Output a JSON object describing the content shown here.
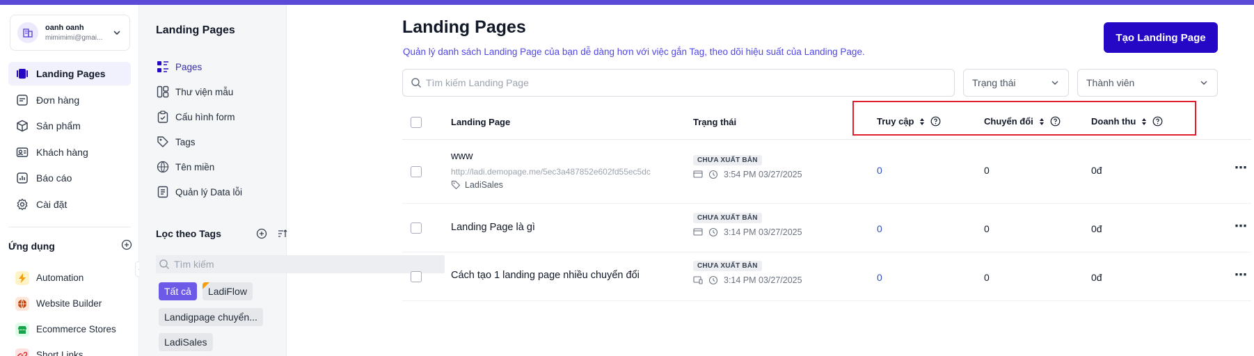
{
  "account": {
    "name": "oanh oanh",
    "email": "mimimimi@gmai..."
  },
  "nav": {
    "items": [
      {
        "label": "Landing Pages",
        "icon": "landing-pages-icon",
        "active": true
      },
      {
        "label": "Đơn hàng",
        "icon": "orders-icon"
      },
      {
        "label": "Sản phẩm",
        "icon": "products-icon"
      },
      {
        "label": "Khách hàng",
        "icon": "customers-icon"
      },
      {
        "label": "Báo cáo",
        "icon": "reports-icon"
      },
      {
        "label": "Cài đặt",
        "icon": "settings-icon"
      }
    ]
  },
  "apps": {
    "title": "Ứng dụng",
    "items": [
      {
        "label": "Automation",
        "icon": "automation-icon",
        "color": "#f59e0b"
      },
      {
        "label": "Website Builder",
        "icon": "website-builder-icon",
        "color": "#c2410c"
      },
      {
        "label": "Ecommerce Stores",
        "icon": "ecommerce-stores-icon",
        "color": "#16a34a"
      },
      {
        "label": "Short Links",
        "icon": "short-links-icon",
        "color": "#dc2626"
      }
    ]
  },
  "subpanel": {
    "title": "Landing Pages",
    "items": [
      {
        "label": "Pages",
        "icon": "pages-icon",
        "active": true
      },
      {
        "label": "Thư viện mẫu",
        "icon": "template-library-icon"
      },
      {
        "label": "Cấu hình form",
        "icon": "form-config-icon"
      },
      {
        "label": "Tags",
        "icon": "tag-icon"
      },
      {
        "label": "Tên miền",
        "icon": "domain-icon"
      },
      {
        "label": "Quản lý Data lỗi",
        "icon": "error-data-icon"
      }
    ],
    "tags_title": "Lọc theo Tags",
    "tags_search_placeholder": "Tìm kiếm",
    "tags": [
      "Tất cả",
      "LadiFlow",
      "Landigpage chuyển...",
      "LadiSales"
    ]
  },
  "main": {
    "title": "Landing Pages",
    "description": "Quản lý danh sách Landing Page của bạn dễ dàng hơn với việc gắn Tag, theo dõi hiệu suất của Landing Page.",
    "create_button": "Tạo Landing Page",
    "search_placeholder": "Tìm kiếm Landing Page",
    "filter_status": "Trạng thái",
    "filter_member": "Thành viên",
    "columns": {
      "landing_page": "Landing Page",
      "status": "Trạng thái",
      "visits": "Truy cập",
      "conversions": "Chuyển đổi",
      "revenue": "Doanh thu"
    },
    "rows": [
      {
        "name": "www",
        "url": "http://ladi.demopage.me/5ec3a487852e602fd55ec5dc",
        "tag": "LadiSales",
        "status": "CHƯA XUẤT BẢN",
        "time": "3:54 PM 03/27/2025",
        "visits": "0",
        "conversions": "0",
        "revenue": "0đ"
      },
      {
        "name": "Landing Page là gì",
        "status": "CHƯA XUẤT BẢN",
        "time": "3:14 PM 03/27/2025",
        "visits": "0",
        "conversions": "0",
        "revenue": "0đ"
      },
      {
        "name": "Cách tạo 1 landing page nhiều chuyển đổi",
        "status": "CHƯA XUẤT BẢN",
        "time": "3:14 PM 03/27/2025",
        "visits": "0",
        "conversions": "0",
        "revenue": "0đ"
      }
    ]
  },
  "colors": {
    "accent": "#2508c6",
    "topbar": "#5b4ad8",
    "highlight": "#e11d2e",
    "tag_selected": "#6d5ae6"
  }
}
